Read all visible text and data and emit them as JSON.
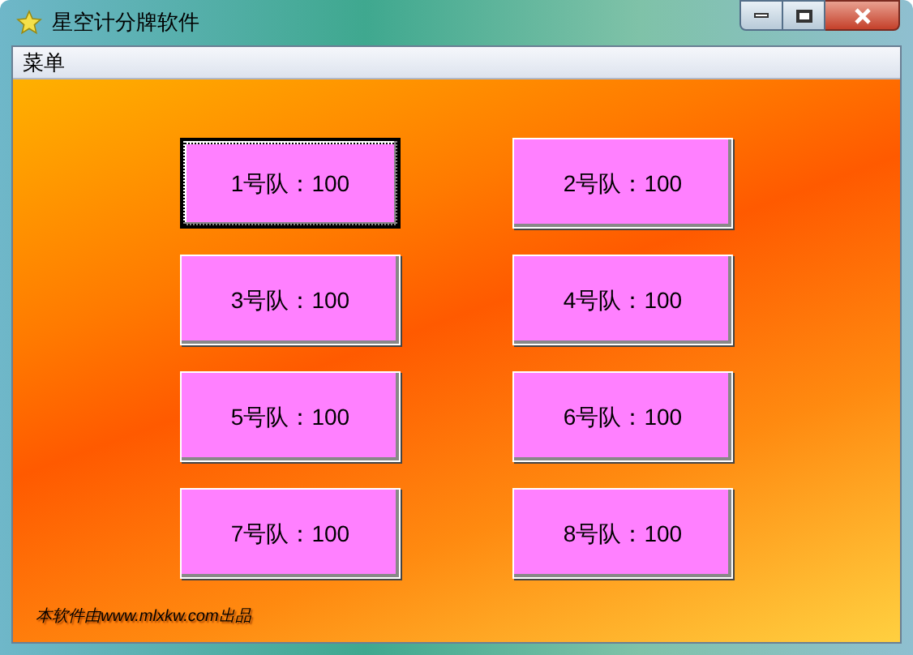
{
  "window": {
    "title": "星空计分牌软件"
  },
  "menu_bar": {
    "items": [
      "菜单"
    ]
  },
  "team_buttons": [
    {
      "label": "1号队：100",
      "selected": true
    },
    {
      "label": "2号队：100",
      "selected": false
    },
    {
      "label": "3号队：100",
      "selected": false
    },
    {
      "label": "4号队：100",
      "selected": false
    },
    {
      "label": "5号队：100",
      "selected": false
    },
    {
      "label": "6号队：100",
      "selected": false
    },
    {
      "label": "7号队：100",
      "selected": false
    },
    {
      "label": "8号队：100",
      "selected": false
    }
  ],
  "footer": "本软件由www.mlxkw.com出品"
}
